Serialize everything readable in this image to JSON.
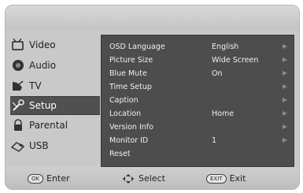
{
  "sidebar": {
    "items": [
      {
        "label": "Video",
        "icon": "tv-screen-icon"
      },
      {
        "label": "Audio",
        "icon": "speaker-icon"
      },
      {
        "label": "TV",
        "icon": "satellite-icon"
      },
      {
        "label": "Setup",
        "icon": "wrench-icon",
        "active": true
      },
      {
        "label": "Parental",
        "icon": "lock-icon"
      },
      {
        "label": "USB",
        "icon": "usb-icon"
      }
    ]
  },
  "menu": {
    "rows": [
      {
        "name": "OSD Language",
        "value": "English",
        "arrow": "▶"
      },
      {
        "name": "Picture Size",
        "value": "Wide Screen",
        "arrow": "▶"
      },
      {
        "name": "Blue Mute",
        "value": "On",
        "arrow": "▶"
      },
      {
        "name": "Time Setup",
        "value": "",
        "arrow": "▶"
      },
      {
        "name": "Caption",
        "value": "",
        "arrow": "▶"
      },
      {
        "name": "Location",
        "value": "Home",
        "arrow": "▶"
      },
      {
        "name": "Version Info",
        "value": "",
        "arrow": "▶"
      },
      {
        "name": "Monitor ID",
        "value": "1",
        "arrow": "▶"
      },
      {
        "name": "Reset",
        "value": "",
        "arrow": ""
      }
    ]
  },
  "footer": {
    "enter_key": "OK",
    "enter_label": "Enter",
    "select_label": "Select",
    "exit_key": "EXIT",
    "exit_label": "Exit"
  }
}
